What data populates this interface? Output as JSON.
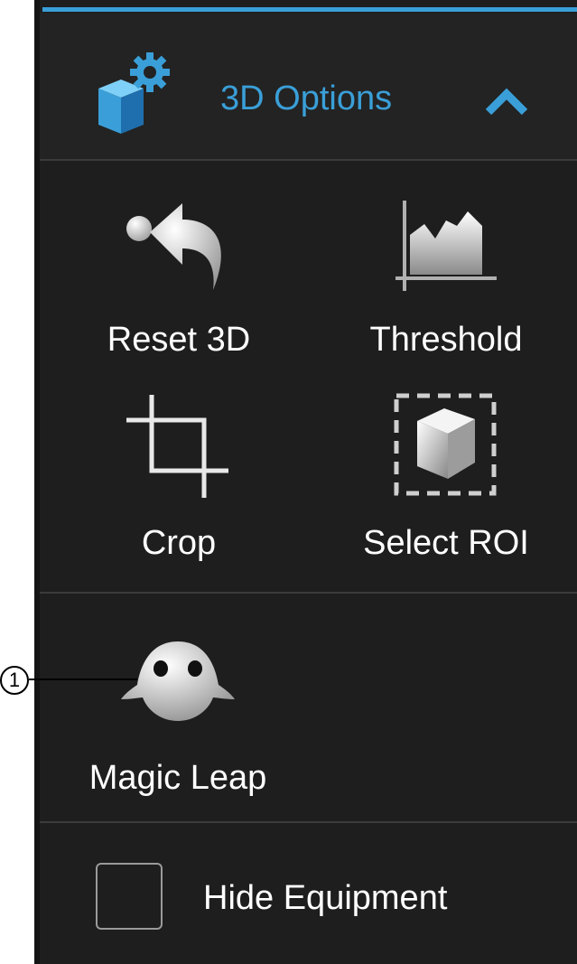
{
  "panel": {
    "accent_color": "#3a9fd8",
    "background_color": "#1e1e1e",
    "header": {
      "title": "3D Options",
      "icon": "cube-gear-icon",
      "toggle_icon": "chevron-up-icon"
    },
    "tools": [
      {
        "label": "Reset 3D",
        "icon": "reset-3d-icon"
      },
      {
        "label": "Threshold",
        "icon": "threshold-icon"
      },
      {
        "label": "Crop",
        "icon": "crop-icon"
      },
      {
        "label": "Select ROI",
        "icon": "select-roi-icon"
      }
    ],
    "magic_leap": {
      "label": "Magic Leap",
      "icon": "magic-leap-icon"
    },
    "hide_equipment": {
      "label": "Hide Equipment",
      "checked": false
    }
  },
  "callout": {
    "number": "1"
  }
}
